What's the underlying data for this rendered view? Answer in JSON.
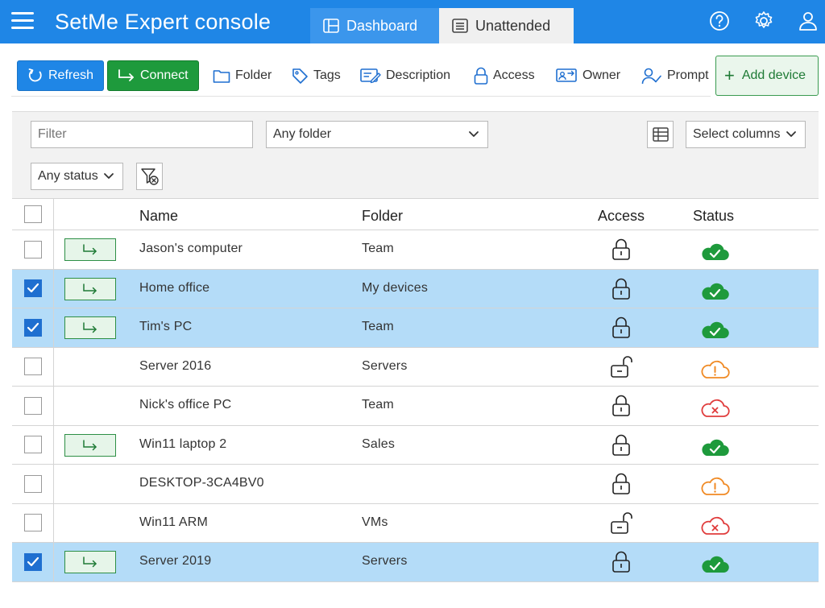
{
  "app": {
    "title": "SetMe Expert console",
    "tabs": [
      {
        "label": "Dashboard",
        "icon": "dashboard-icon",
        "active": true
      },
      {
        "label": "Unattended",
        "icon": "list-icon",
        "active": false
      }
    ],
    "header_icons": [
      "help-icon",
      "settings-icon",
      "user-icon"
    ]
  },
  "toolbar": {
    "refresh_label": "Refresh",
    "connect_label": "Connect",
    "folder_label": "Folder",
    "tags_label": "Tags",
    "description_label": "Description",
    "access_label": "Access",
    "owner_label": "Owner",
    "prompt_label": "Prompt",
    "add_device_label": "Add device"
  },
  "filters": {
    "filter_placeholder": "Filter",
    "folder_value": "Any folder",
    "columns_value": "Select columns",
    "status_value": "Any status"
  },
  "table": {
    "headers": {
      "name": "Name",
      "folder": "Folder",
      "access": "Access",
      "status": "Status"
    },
    "rows": [
      {
        "name": "Jason's computer",
        "folder": "Team",
        "selected": false,
        "connectable": true,
        "access": "locked",
        "status": "online"
      },
      {
        "name": "Home office",
        "folder": "My devices",
        "selected": true,
        "connectable": true,
        "access": "locked",
        "status": "online"
      },
      {
        "name": "Tim's PC",
        "folder": "Team",
        "selected": true,
        "connectable": true,
        "access": "locked",
        "status": "online"
      },
      {
        "name": "Server 2016",
        "folder": "Servers",
        "selected": false,
        "connectable": false,
        "access": "unlocked",
        "status": "warning"
      },
      {
        "name": "Nick's office PC",
        "folder": "Team",
        "selected": false,
        "connectable": false,
        "access": "locked",
        "status": "offline"
      },
      {
        "name": "Win11 laptop 2",
        "folder": "Sales",
        "selected": false,
        "connectable": true,
        "access": "locked",
        "status": "online"
      },
      {
        "name": "DESKTOP-3CA4BV0",
        "folder": "",
        "selected": false,
        "connectable": false,
        "access": "locked",
        "status": "warning"
      },
      {
        "name": "Win11 ARM",
        "folder": "VMs",
        "selected": false,
        "connectable": false,
        "access": "unlocked",
        "status": "offline"
      },
      {
        "name": "Server 2019",
        "folder": "Servers",
        "selected": true,
        "connectable": true,
        "access": "locked",
        "status": "online"
      }
    ]
  },
  "colors": {
    "header_bg": "#1f86e6",
    "connect_green": "#1e9a3c",
    "selected_row": "#b4dcf8",
    "status_online": "#1e9a3c",
    "status_warning": "#f08a24",
    "status_offline": "#e03c3c"
  }
}
